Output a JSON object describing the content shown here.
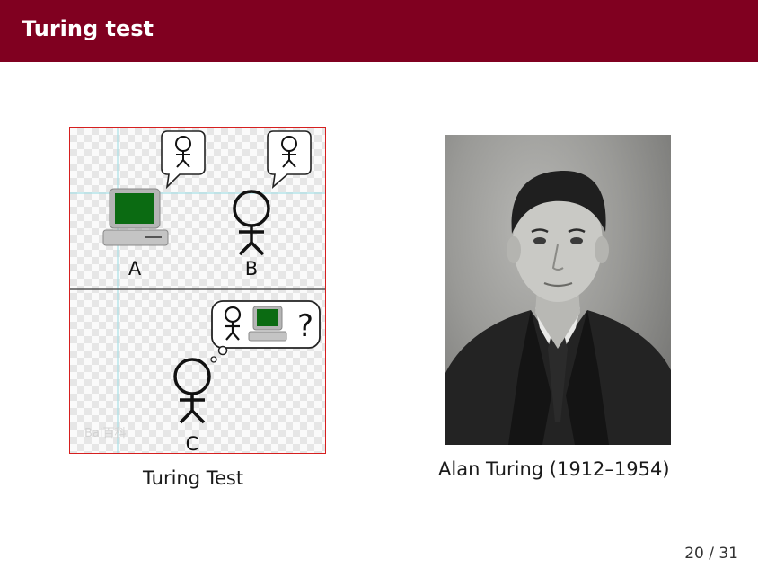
{
  "header": {
    "title": "Turing test",
    "bg_color": "#800020"
  },
  "figure_left": {
    "label_a": "A",
    "label_b": "B",
    "label_c": "C",
    "question_mark": "?",
    "watermark": "Bai百科",
    "caption": "Turing Test",
    "border_color": "#d61f1f",
    "screen_color": "#0b6b12"
  },
  "figure_right": {
    "subject": "portrait-photo",
    "caption": "Alan Turing (1912–1954)"
  },
  "footer": {
    "page_number": "20 / 31"
  }
}
